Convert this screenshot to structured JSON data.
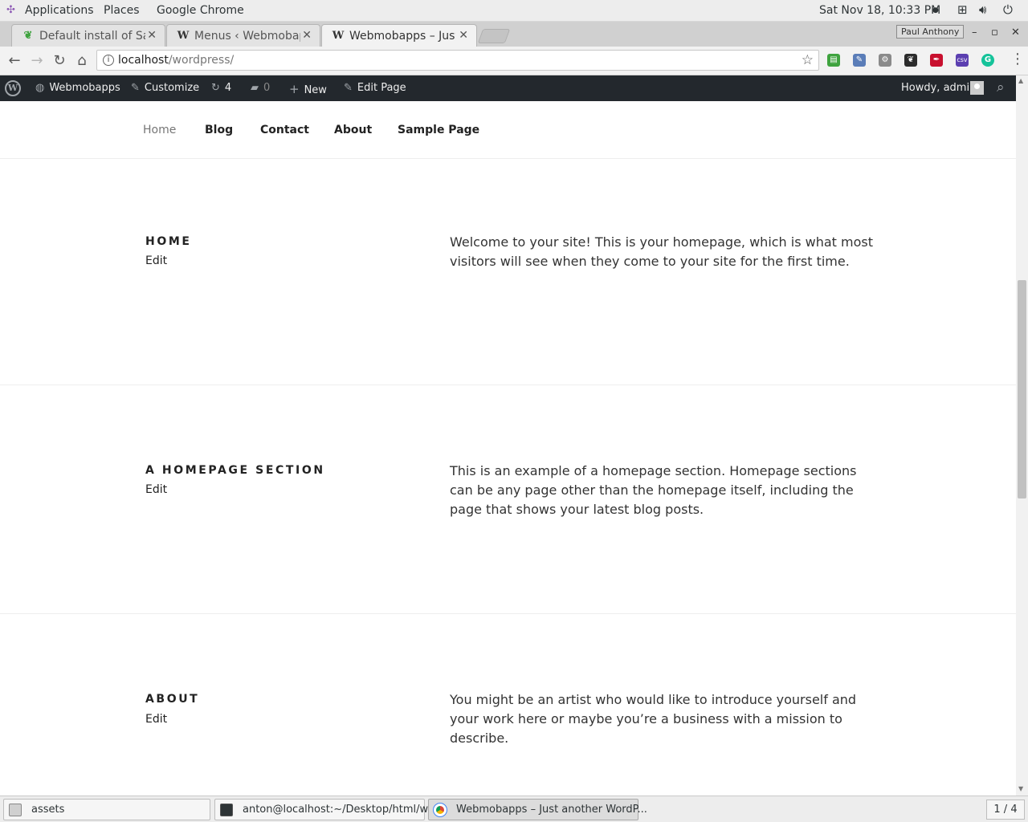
{
  "system_bar": {
    "applications": "Applications",
    "places": "Places",
    "browser_app": "Google Chrome",
    "clock": "Sat Nov 18, 10:33 PM",
    "recording_dot": "●"
  },
  "browser": {
    "tabs": [
      {
        "label": "Default install of Sa",
        "icon": "leaf-icon",
        "close": "✕"
      },
      {
        "label": "Menus ‹ Webmobap",
        "icon": "W",
        "close": "✕"
      },
      {
        "label": "Webmobapps – Just",
        "icon": "W",
        "close": "✕"
      }
    ],
    "profile_badge": "Paul Anthony",
    "window_controls": {
      "minimize": "–",
      "maximize": "▫",
      "close": "✕"
    },
    "nav": {
      "back": "←",
      "forward": "→",
      "reload": "↻",
      "home": "⌂"
    },
    "omnibox": {
      "info": "i",
      "host": "localhost",
      "path": "/wordpress/",
      "star": "☆"
    },
    "extensions": [
      {
        "name": "green-ext-icon",
        "color": "#3fa33f",
        "glyph": "▤"
      },
      {
        "name": "eyedropper-ext-icon",
        "color": "#5a7db8",
        "glyph": "✎"
      },
      {
        "name": "gears-ext-icon",
        "color": "#8a8a8a",
        "glyph": "⚙"
      },
      {
        "name": "evernote-ext-icon",
        "color": "#2c2c2c",
        "glyph": "❦"
      },
      {
        "name": "pdf-ext-icon",
        "color": "#c8102e",
        "glyph": "✒"
      },
      {
        "name": "csv-ext-icon",
        "color": "#5b3fb0",
        "glyph": "csv"
      },
      {
        "name": "grammarly-ext-icon",
        "color": "#15c39a",
        "glyph": "G"
      }
    ],
    "menu": "⋮"
  },
  "admin_bar": {
    "wp_logo": "W",
    "site_name": "Webmobapps",
    "customize": "Customize",
    "updates_count": "4",
    "comments_count": "0",
    "new_label": "New",
    "edit_page": "Edit Page",
    "howdy": "Howdy, admin",
    "search": "⌕"
  },
  "site_nav": {
    "items": [
      "Home",
      "Blog",
      "Contact",
      "About",
      "Sample Page"
    ]
  },
  "sections": [
    {
      "title": "HOME",
      "edit": "Edit",
      "body": "Welcome to your site! This is your homepage, which is what most visitors will see when they come to your site for the first time."
    },
    {
      "title": "A HOMEPAGE SECTION",
      "edit": "Edit",
      "body": "This is an example of a homepage section. Homepage sections can be any page other than the homepage itself, including the page that shows your latest blog posts."
    },
    {
      "title": "ABOUT",
      "edit": "Edit",
      "body": "You might be an artist who would like to introduce yourself and your work here or maybe you’re a business with a mission to describe."
    }
  ],
  "taskbar": {
    "tasks": [
      {
        "label": "assets"
      },
      {
        "label": "anton@localhost:~/Desktop/html/w..."
      },
      {
        "label": "Webmobapps – Just another WordP..."
      }
    ],
    "pager": "1 / 4"
  }
}
